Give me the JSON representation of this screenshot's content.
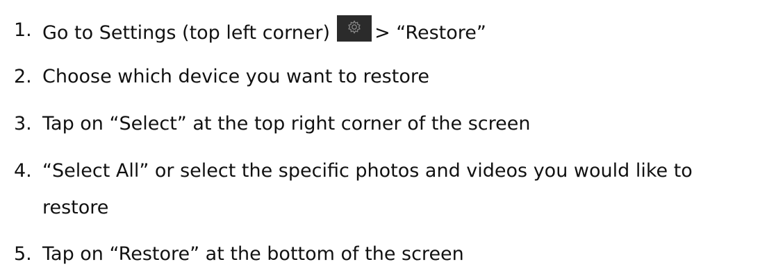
{
  "steps": [
    {
      "number": "1.",
      "text_before_icon": "Go to Settings (top left corner)",
      "icon": "gear-icon",
      "text_after_icon": "> “Restore”"
    },
    {
      "number": "2.",
      "text": "Choose which device you want to restore"
    },
    {
      "number": "3.",
      "text": "Tap on “Select” at the top right corner of the screen"
    },
    {
      "number": "4.",
      "text": "“Select All” or  select the specific photos and videos you would like to",
      "continuation": "restore"
    },
    {
      "number": "5.",
      "text": "Tap on “Restore” at the bottom of the screen"
    }
  ],
  "colors": {
    "text": "#111111",
    "icon_background": "#2b2b2b",
    "icon_stroke": "#8a8a8a"
  }
}
